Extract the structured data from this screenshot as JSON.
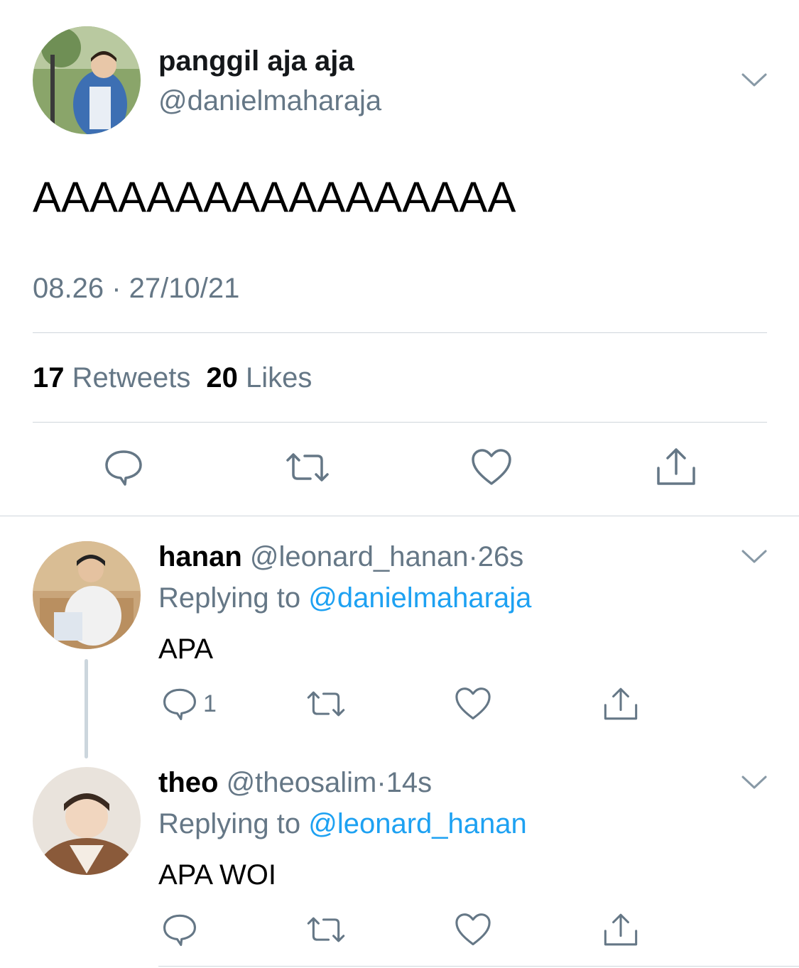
{
  "main_tweet": {
    "display_name": "panggil aja aja",
    "handle": "@danielmaharaja",
    "text": "AAAAAAAAAAAAAAAAA",
    "timestamp": "08.26 · 27/10/21",
    "retweets_count": "17",
    "retweets_label": "Retweets",
    "likes_count": "20",
    "likes_label": "Likes",
    "avatar_icon": "avatar-photo",
    "menu_icon": "chevron-down-icon"
  },
  "replies": [
    {
      "display_name": "hanan",
      "handle": "@leonard_hanan",
      "separator": "·",
      "time": "26s",
      "replying_prefix": "Replying to",
      "replying_to": "@danielmaharaja",
      "text": "APA",
      "reply_count": "1"
    },
    {
      "display_name": "theo",
      "handle": "@theosalim",
      "separator": "·",
      "time": "14s",
      "replying_prefix": "Replying to",
      "replying_to": "@leonard_hanan",
      "text": "APA WOI",
      "reply_count": ""
    }
  ],
  "colors": {
    "text_primary": "#14171a",
    "text_secondary": "#657786",
    "link": "#1da1f2",
    "divider": "#cfd6dc",
    "icon": "#657786"
  }
}
